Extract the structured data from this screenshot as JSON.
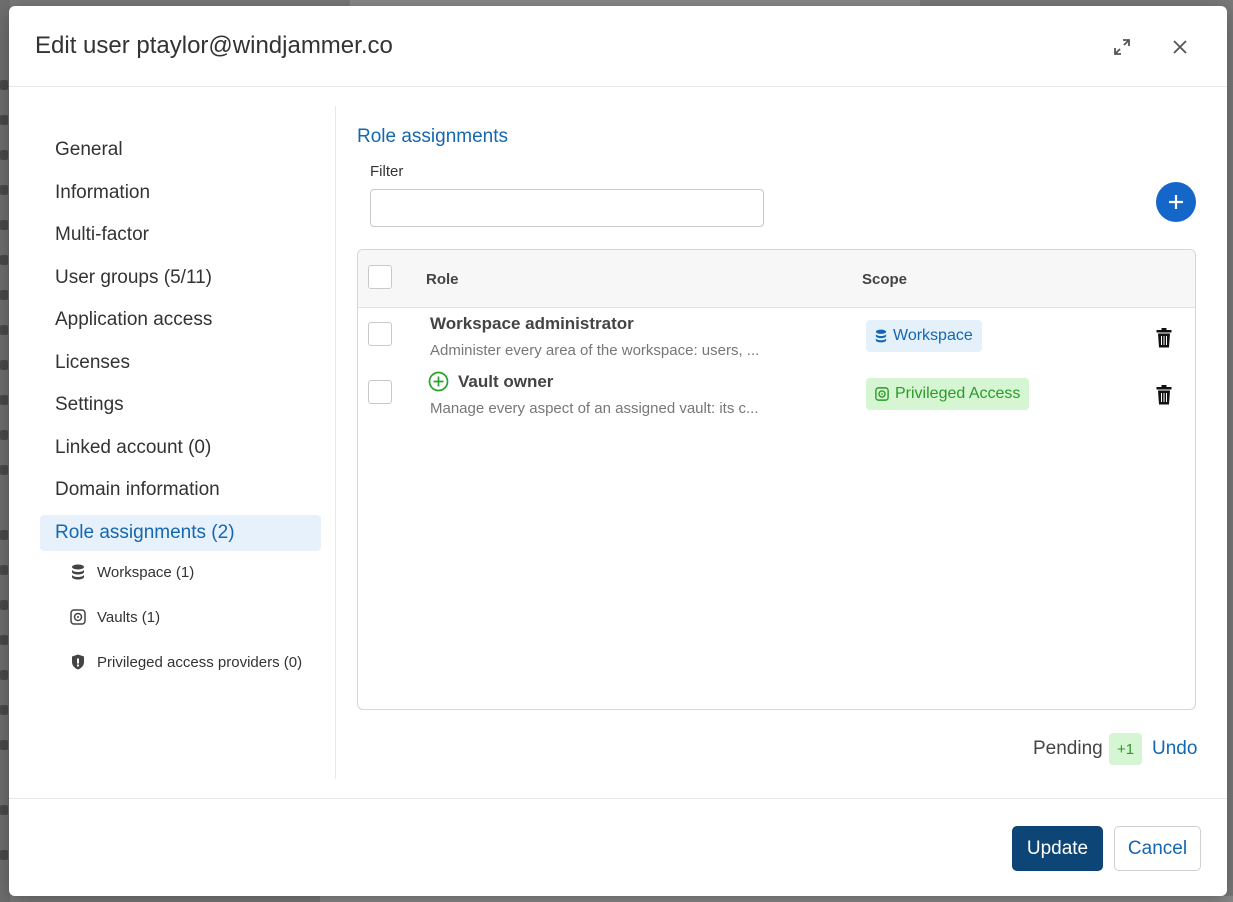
{
  "dialog": {
    "title": "Edit user ptaylor@windjammer.co",
    "expand_icon": "expand-icon",
    "close_icon": "close-icon"
  },
  "sidebar": {
    "items": [
      {
        "label": "General"
      },
      {
        "label": "Information"
      },
      {
        "label": "Multi-factor"
      },
      {
        "label": "User groups (5/11)"
      },
      {
        "label": "Application access"
      },
      {
        "label": "Licenses"
      },
      {
        "label": "Settings"
      },
      {
        "label": "Linked account (0)"
      },
      {
        "label": "Domain information"
      },
      {
        "label": "Role assignments (2)",
        "active": true
      }
    ],
    "sub_items": [
      {
        "label": "Workspace (1)",
        "icon": "database-icon"
      },
      {
        "label": "Vaults (1)",
        "icon": "vault-icon"
      },
      {
        "label": "Privileged access providers (0)",
        "icon": "shield-icon"
      }
    ]
  },
  "main": {
    "section_title": "Role assignments",
    "filter": {
      "label": "Filter",
      "value": "",
      "placeholder": ""
    },
    "add_button_icon": "plus-icon",
    "grid": {
      "columns": {
        "role": "Role",
        "scope": "Scope"
      },
      "rows": [
        {
          "role": "Workspace administrator",
          "description": "Administer every area of the workspace: users, ...",
          "scope": "Workspace",
          "scope_icon": "database-icon",
          "pending_add": false
        },
        {
          "role": "Vault owner",
          "description": "Manage every aspect of an assigned vault: its c...",
          "scope": "Privileged Access",
          "scope_icon": "vault-icon",
          "pending_add": true
        }
      ]
    },
    "pending": {
      "label": "Pending",
      "count": "+1",
      "undo": "Undo"
    }
  },
  "footer": {
    "update": "Update",
    "cancel": "Cancel"
  },
  "colors": {
    "accent": "#1467b0",
    "primary_button": "#0d4577",
    "active_nav_bg": "#e6f1fb",
    "success_bg": "#d6f5d2",
    "success_text": "#2a9b2a"
  }
}
